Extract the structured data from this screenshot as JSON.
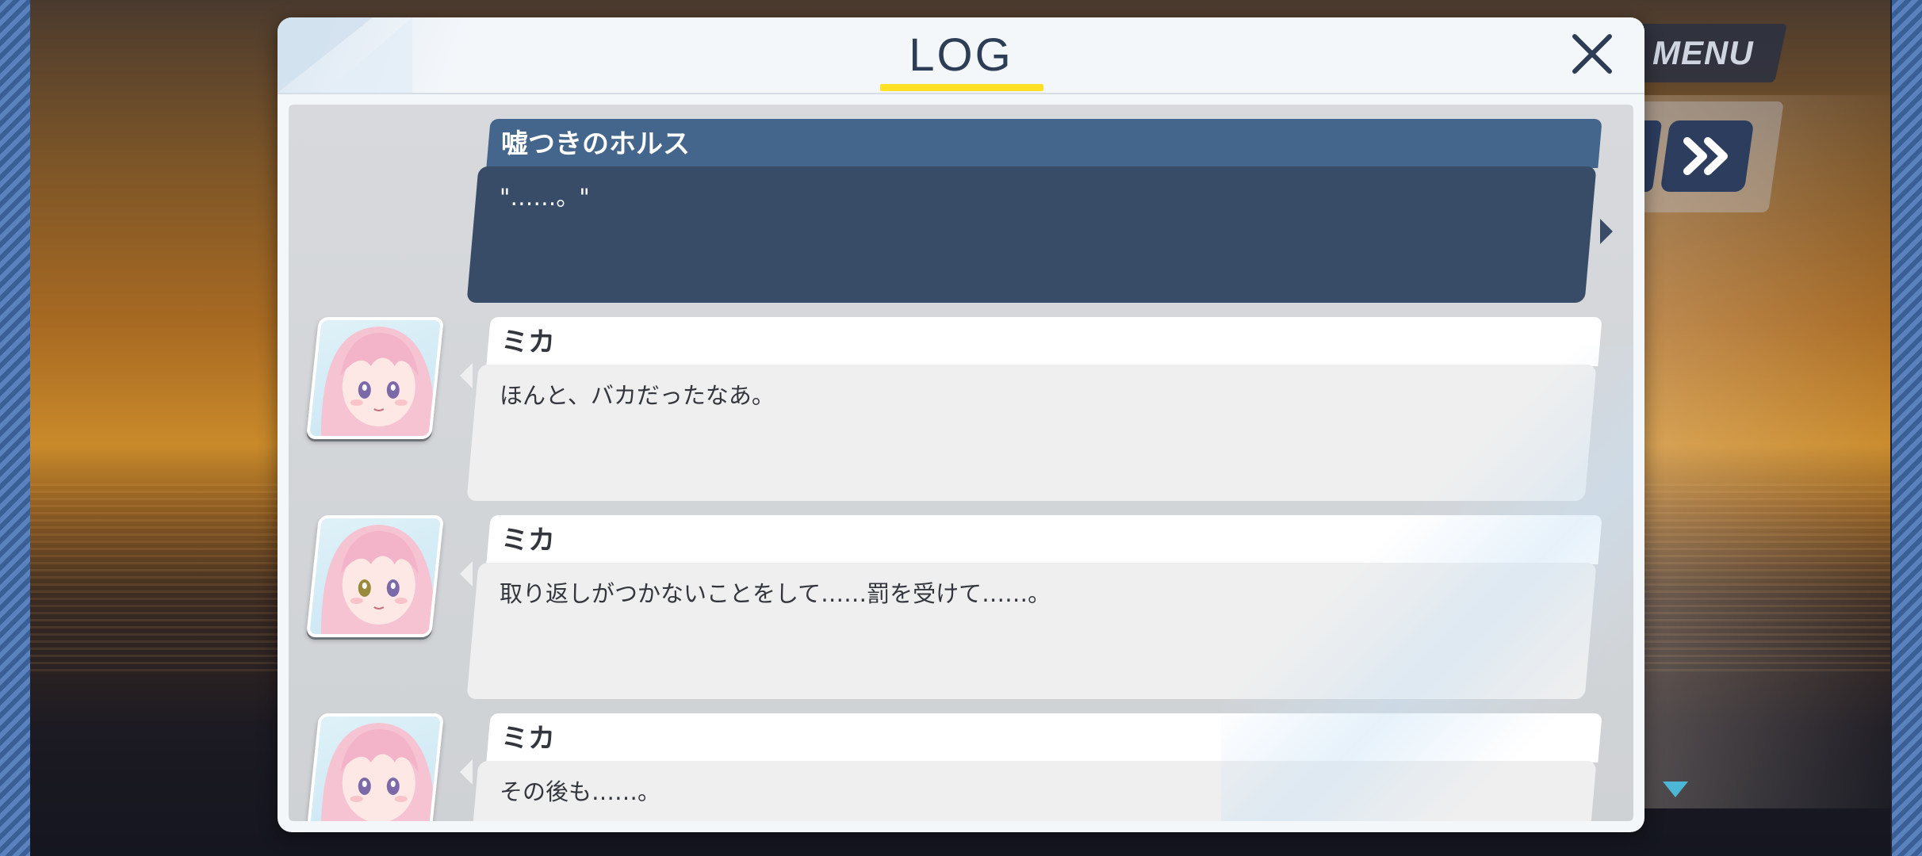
{
  "hud": {
    "menu_label": "MENU"
  },
  "dialog": {
    "title": "LOG"
  },
  "entries": [
    {
      "type": "narration",
      "speaker": "嘘つきのホルス",
      "text": "\"……。\""
    },
    {
      "type": "character",
      "speaker": "ミカ",
      "text": "ほんと、バカだったなあ。"
    },
    {
      "type": "character",
      "speaker": "ミカ",
      "text": "取り返しがつかないことをして……罰を受けて……。"
    },
    {
      "type": "character",
      "speaker": "ミカ",
      "text": "その後も……。"
    }
  ],
  "colors": {
    "accent_underline": "#ffe228",
    "narration_header": "#44658c",
    "narration_body": "#384c68",
    "character_header": "#ffffff",
    "character_body": "#efefef"
  },
  "icons": [
    "close-icon",
    "fast-forward-icon",
    "scroll-down-indicator-icon"
  ]
}
